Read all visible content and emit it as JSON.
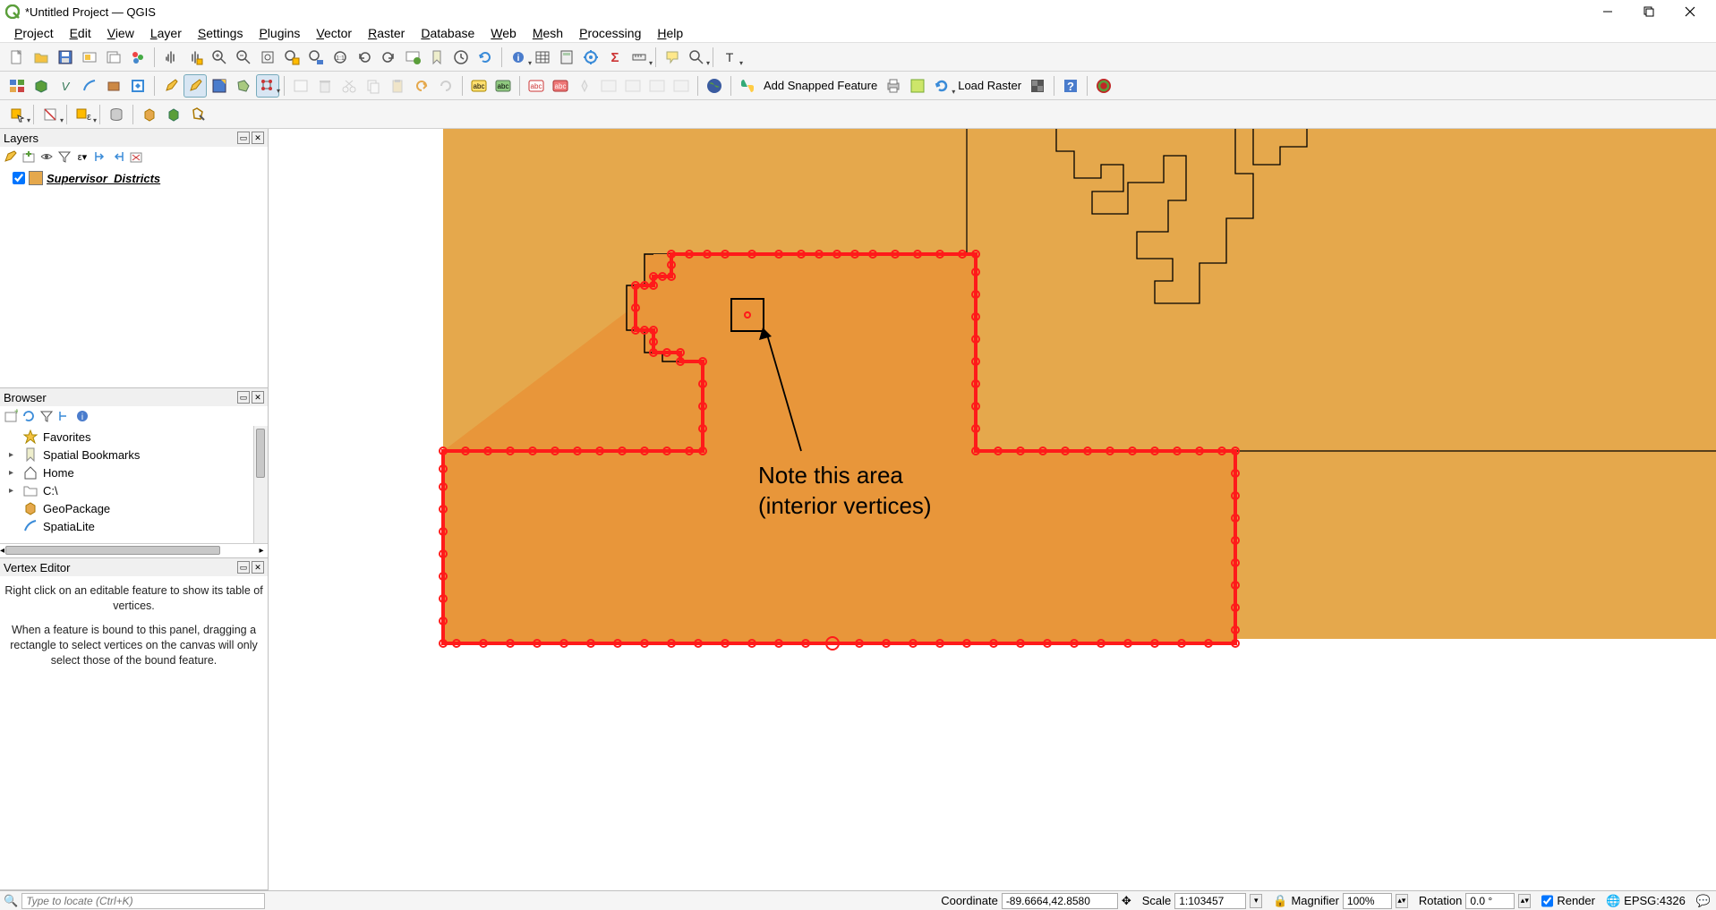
{
  "window": {
    "title": "*Untitled Project — QGIS"
  },
  "menus": [
    "Project",
    "Edit",
    "View",
    "Layer",
    "Settings",
    "Plugins",
    "Vector",
    "Raster",
    "Database",
    "Web",
    "Mesh",
    "Processing",
    "Help"
  ],
  "toolbar3_labels": {
    "add_snapped": "Add Snapped Feature",
    "load_raster": "Load Raster"
  },
  "layers_panel": {
    "title": "Layers",
    "layer_name": "Supervisor_Districts"
  },
  "browser_panel": {
    "title": "Browser",
    "items": [
      "Favorites",
      "Spatial Bookmarks",
      "Home",
      "C:\\",
      "GeoPackage",
      "SpatiaLite"
    ]
  },
  "vertex_panel": {
    "title": "Vertex Editor",
    "msg1": "Right click on an editable feature to show its table of vertices.",
    "msg2": "When a feature is bound to this panel, dragging a rectangle to select vertices on the canvas will only select those of the bound feature."
  },
  "status": {
    "locate_placeholder": "Type to locate (Ctrl+K)",
    "coord_label": "Coordinate",
    "coord_value": "-89.6664,42.8580",
    "scale_label": "Scale",
    "scale_value": "1:103457",
    "magnifier_label": "Magnifier",
    "magnifier_value": "100%",
    "rotation_label": "Rotation",
    "rotation_value": "0.0 °",
    "render_label": "Render",
    "crs": "EPSG:4326"
  },
  "annotation": {
    "line1": "Note this area",
    "line2": "(interior vertices)"
  },
  "colors": {
    "polygon_base": "#e5a84c",
    "polygon_selected": "#e8963a",
    "vertex_red": "#ff1a1a"
  }
}
